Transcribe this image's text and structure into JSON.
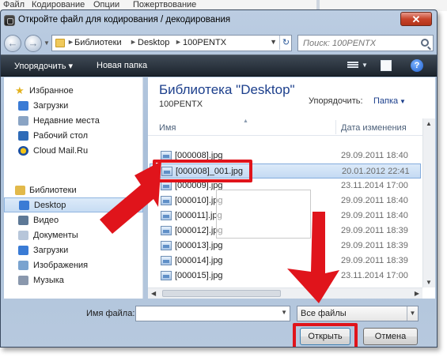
{
  "menubar": {
    "items": [
      "Файл",
      "Кодирование",
      "Опции",
      "Пожертвование"
    ]
  },
  "dialog": {
    "title": "Откройте файл для кодирования / декодирования",
    "close": "✕"
  },
  "address": {
    "crumbs": [
      "Библиотеки",
      "Desktop",
      "100PENTX"
    ],
    "search_placeholder": "Поиск: 100PENTX"
  },
  "toolbar": {
    "organize": "Упорядочить ▾",
    "new_folder": "Новая папка",
    "help": "?"
  },
  "nav": {
    "favorites_header": "Избранное",
    "favorites": [
      "Загрузки",
      "Недавние места",
      "Рабочий стол",
      "Cloud Mail.Ru"
    ],
    "libraries_header": "Библиотеки",
    "libraries": [
      "Desktop",
      "Видео",
      "Документы",
      "Загрузки",
      "Изображения",
      "Музыка"
    ]
  },
  "content": {
    "library_title": "Библиотека \"Desktop\"",
    "library_subtitle": "100PENTX",
    "arrange_label": "Упорядочить:",
    "arrange_value": "Папка",
    "col_name": "Имя",
    "col_date": "Дата изменения",
    "files": [
      {
        "name": "[000008].jpg",
        "date": "29.09.2011 18:40"
      },
      {
        "name": "[000008]_001.jpg",
        "date": "20.01.2012 22:41"
      },
      {
        "name": "[000009].jpg",
        "date": "23.11.2014 17:00"
      },
      {
        "name": "[000010].jpg",
        "date": "29.09.2011 18:40"
      },
      {
        "name": "[000011].jpg",
        "date": "29.09.2011 18:40"
      },
      {
        "name": "[000012].jpg",
        "date": "29.09.2011 18:39"
      },
      {
        "name": "[000013].jpg",
        "date": "29.09.2011 18:39"
      },
      {
        "name": "[000014].jpg",
        "date": "29.09.2011 18:39"
      },
      {
        "name": "[000015].jpg",
        "date": "23.11.2014 17:00"
      }
    ]
  },
  "bottom": {
    "filename_label": "Имя файла:",
    "filename_value": "",
    "filter": "Все файлы",
    "open": "Открыть",
    "cancel": "Отмена"
  },
  "colors": {
    "annotation_red": "#e0141b",
    "title_blue": "#1c3f8c",
    "toolbar_dark": "#1c242d"
  }
}
